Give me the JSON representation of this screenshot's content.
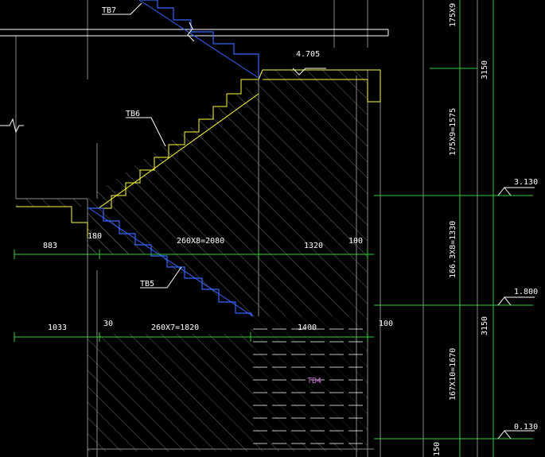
{
  "labels": {
    "tb7": "TB7",
    "tb6": "TB6",
    "tb5": "TB5",
    "tb4": "TB4",
    "elev_4705": "4.705",
    "elev_3130": "3.130",
    "elev_1800": "1.800",
    "elev_0130": "0.130"
  },
  "dimensions_horizontal": {
    "upper_left": "883",
    "upper_gap": "180",
    "upper_run": "260X8=2080",
    "upper_landing": "1320",
    "upper_right": "100",
    "lower_left": "1033",
    "lower_gap": "30",
    "lower_run": "260X7=1820",
    "lower_landing": "1400",
    "lower_right": "100"
  },
  "dimensions_vertical": {
    "top_rise": "175X9=1575",
    "top_rise_clip": "175X9",
    "mid_rise": "166.3X8=1330",
    "low_rise": "167X10=1670",
    "low_small": "150",
    "total_upper": "3150",
    "total_lower": "3150"
  },
  "colors": {
    "background": "#000000",
    "stair": "#ffff33",
    "break_line": "#3366ff",
    "dimension": "#33cc33",
    "white": "#ffffff",
    "grey": "#8a8a8a",
    "hatch": "#6b6b6b",
    "label_magenta": "#c96bd6"
  }
}
